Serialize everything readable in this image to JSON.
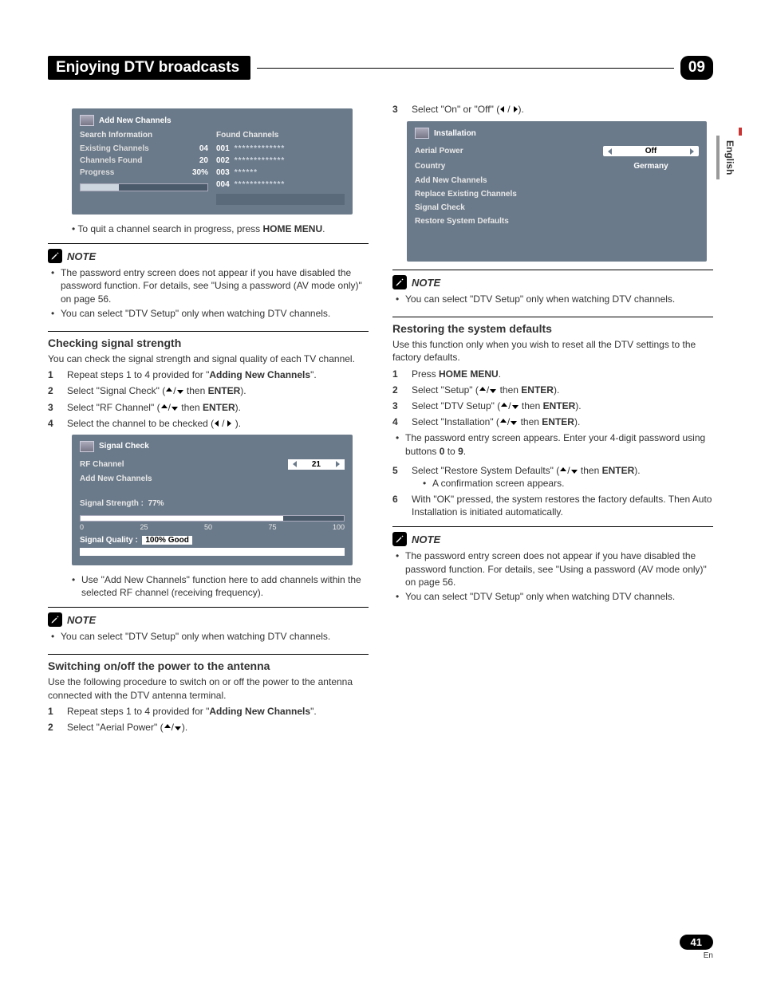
{
  "header": {
    "title": "Enjoying DTV broadcasts",
    "chapter": "09"
  },
  "sideTab": "English",
  "footer": {
    "page": "41",
    "lang": "En"
  },
  "osdAdd": {
    "title": "Add New Channels",
    "searchInfo": "Search Information",
    "foundLabel": "Found Channels",
    "rows": [
      {
        "k": "Existing Channels",
        "v": "04"
      },
      {
        "k": "Channels Found",
        "v": "20"
      },
      {
        "k": "Progress",
        "v": "30%"
      }
    ],
    "found": [
      {
        "n": "001",
        "dots": "*************"
      },
      {
        "n": "002",
        "dots": "*************"
      },
      {
        "n": "003",
        "dots": "******"
      },
      {
        "n": "004",
        "dots": "*************"
      }
    ]
  },
  "quitLine": {
    "pre": "To quit a channel search in progress, press ",
    "bold": "HOME MENU",
    "post": "."
  },
  "noteLabel": "NOTE",
  "note1": [
    "The password entry screen does not appear if you have disabled the password function. For details, see \"Using a password (AV mode only)\" on page 56.",
    "You can select \"DTV Setup\" only when watching DTV channels."
  ],
  "checking": {
    "heading": "Checking signal strength",
    "intro": "You can check the signal strength and signal quality of each TV channel.",
    "steps": [
      {
        "n": "1",
        "pre": "Repeat steps 1 to 4 provided for \"",
        "bold": "Adding New Channels",
        "post": "\"."
      },
      {
        "n": "2",
        "pre": "Select \"Signal Check\" (",
        "arrows": "ud",
        "mid": " then ",
        "bold": "ENTER",
        "post": ")."
      },
      {
        "n": "3",
        "pre": "Select \"RF Channel\" (",
        "arrows": "ud",
        "mid": " then ",
        "bold": "ENTER",
        "post": ")."
      },
      {
        "n": "4",
        "pre": "Select the channel to be checked (",
        "arrows": "lr",
        "post": " )."
      }
    ]
  },
  "osdSignal": {
    "title": "Signal Check",
    "rf": "RF Channel",
    "rfVal": "21",
    "add": "Add New Channels",
    "strengthLabel": "Signal Strength  :",
    "strengthVal": "77%",
    "scale": [
      "0",
      "25",
      "50",
      "75",
      "100"
    ],
    "qualityLabel": "Signal Quality   :",
    "qualityVal": "100%  Good"
  },
  "afterSignal": [
    "Use \"Add New Channels\" function here to add channels within the selected RF channel (receiving frequency)."
  ],
  "note2": [
    "You can select \"DTV Setup\" only when watching DTV channels."
  ],
  "antenna": {
    "heading": "Switching on/off the power to the antenna",
    "intro": "Use the following procedure to switch on or off the power to the antenna connected with the DTV antenna terminal.",
    "steps": [
      {
        "n": "1",
        "pre": "Repeat steps 1 to 4 provided for \"",
        "bold": "Adding New Channels",
        "post": "\"."
      },
      {
        "n": "2",
        "pre": "Select \"Aerial Power\" (",
        "arrows": "ud",
        "post": ")."
      }
    ]
  },
  "rightTop": {
    "step": {
      "n": "3",
      "pre": "Select \"On\" or \"Off\" (",
      "arrows": "lr",
      "post": ")."
    }
  },
  "osdInstall": {
    "title": "Installation",
    "rows": [
      {
        "label": "Aerial Power",
        "sel": "Off",
        "type": "selector"
      },
      {
        "label": "Country",
        "sel": "Germany",
        "type": "plain"
      },
      {
        "label": "Add New Channels"
      },
      {
        "label": "Replace Existing Channels"
      },
      {
        "label": "Signal Check"
      },
      {
        "label": "Restore System Defaults"
      }
    ]
  },
  "note3": [
    "You can select \"DTV Setup\" only when watching DTV channels."
  ],
  "restore": {
    "heading": "Restoring the system defaults",
    "intro": "Use this function only when you wish to reset all the DTV settings to the factory defaults.",
    "steps": [
      {
        "n": "1",
        "pre": "Press ",
        "bold": "HOME MENU",
        "post": "."
      },
      {
        "n": "2",
        "pre": "Select \"Setup\" (",
        "arrows": "ud",
        "mid": " then ",
        "bold": "ENTER",
        "post": ")."
      },
      {
        "n": "3",
        "pre": "Select \"DTV Setup\" (",
        "arrows": "ud",
        "mid": " then ",
        "bold": "ENTER",
        "post": ")."
      },
      {
        "n": "4",
        "pre": "Select \"Installation\" (",
        "arrows": "ud",
        "mid": " then ",
        "bold": "ENTER",
        "post": ")."
      }
    ],
    "afterStep4": [
      "The password entry screen appears. Enter your 4-digit password using buttons 0 to 9."
    ],
    "afterStep4_fmt": {
      "pre": "The password entry screen appears. Enter your 4-digit password using buttons ",
      "b1": "0",
      "mid": " to ",
      "b2": "9",
      "post": "."
    },
    "step5": {
      "n": "5",
      "pre": "Select \"Restore System Defaults\" (",
      "arrows": "ud",
      "mid": " then ",
      "bold": "ENTER",
      "post": ")."
    },
    "step5sub": "A confirmation screen appears.",
    "step6": {
      "n": "6",
      "txt": "With \"OK\" pressed, the system restores the factory defaults. Then Auto Installation is initiated automatically."
    }
  },
  "note4": [
    "The password entry screen does not appear if you have disabled the password function. For details, see \"Using a password (AV mode only)\" on page 56.",
    "You can select \"DTV Setup\" only when watching DTV channels."
  ]
}
